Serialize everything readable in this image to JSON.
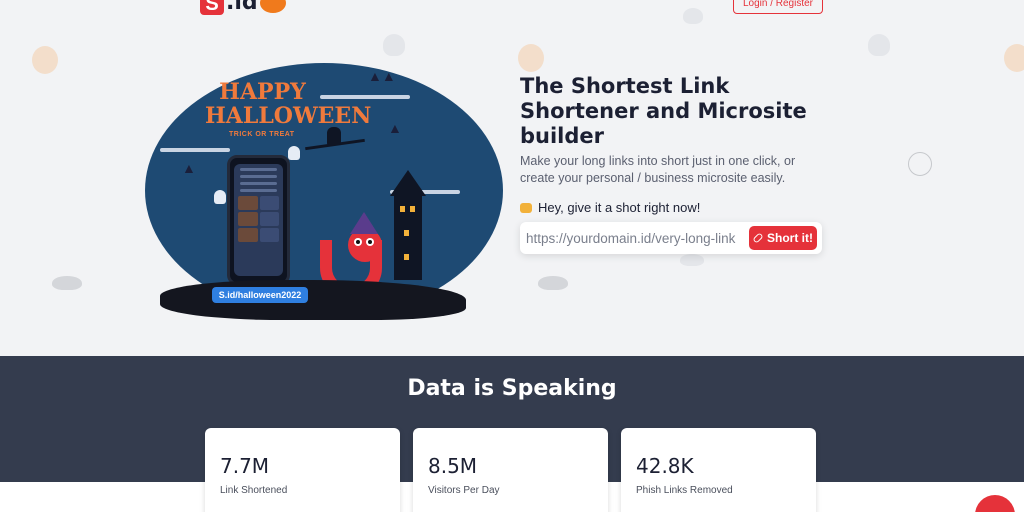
{
  "header": {
    "logo_text": ".id",
    "logo_mark": "S",
    "login_label": "Login / Register"
  },
  "hero": {
    "illustration": {
      "title": "HAPPY HALLOWEEN",
      "subtitle": "TRICK OR TREAT",
      "url_badge": "S.id/halloween2022"
    },
    "title": "The Shortest Link Shortener and Microsite builder",
    "description": "Make your long links into short just in one click, or create your personal / business microsite easily.",
    "hint": "Hey, give it a shot right now!",
    "hint_icon": "pointing-hand-icon",
    "input_placeholder": "https://yourdomain.id/very-long-link",
    "button_label": "Short it!",
    "button_icon": "link-icon"
  },
  "stats": {
    "title": "Data is Speaking",
    "items": [
      {
        "value": "7.7M",
        "label": "Link Shortened"
      },
      {
        "value": "8.5M",
        "label": "Visitors Per Day"
      },
      {
        "value": "42.8K",
        "label": "Phish Links Removed"
      }
    ]
  },
  "colors": {
    "brand": "#e5323a",
    "dark_section": "#343c4e",
    "page_bg": "#f2f3f5"
  }
}
